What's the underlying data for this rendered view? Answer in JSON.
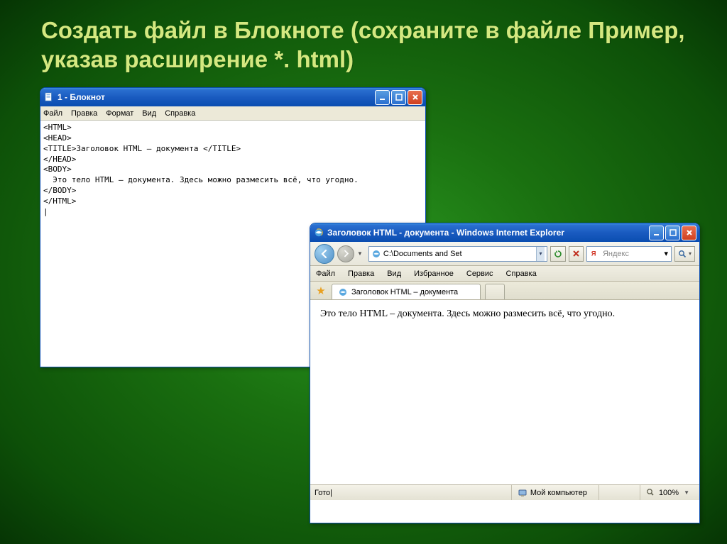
{
  "slide_title": "Создать файл в Блокноте (сохраните в файле Пример,  указав расширение  *. html)",
  "notepad": {
    "title": "1 - Блокнот",
    "menu": [
      "Файл",
      "Правка",
      "Формат",
      "Вид",
      "Справка"
    ],
    "lines": [
      "<HTML>",
      "<HEAD>",
      "<TITLE>Заголовок HTML – документа </TITLE>",
      "</HEAD>",
      "<BODY>",
      "  Это тело HTML – документа. Здесь можно размесить всё, что угодно.",
      "</BODY>",
      "</HTML>",
      "|"
    ]
  },
  "ie": {
    "title": "Заголовок HTML - документа - Windows Internet Explorer",
    "address": "C:\\Documents and Set",
    "search_placeholder": "Яндекс",
    "menu": [
      "Файл",
      "Правка",
      "Вид",
      "Избранное",
      "Сервис",
      "Справка"
    ],
    "tab_label": "Заголовок HTML – документа",
    "body_text": "Это тело HTML – документа. Здесь можно размесить всё, что угодно.",
    "status_left": "Гото|",
    "status_zone": "Мой компьютер",
    "status_zoom": "100%"
  }
}
